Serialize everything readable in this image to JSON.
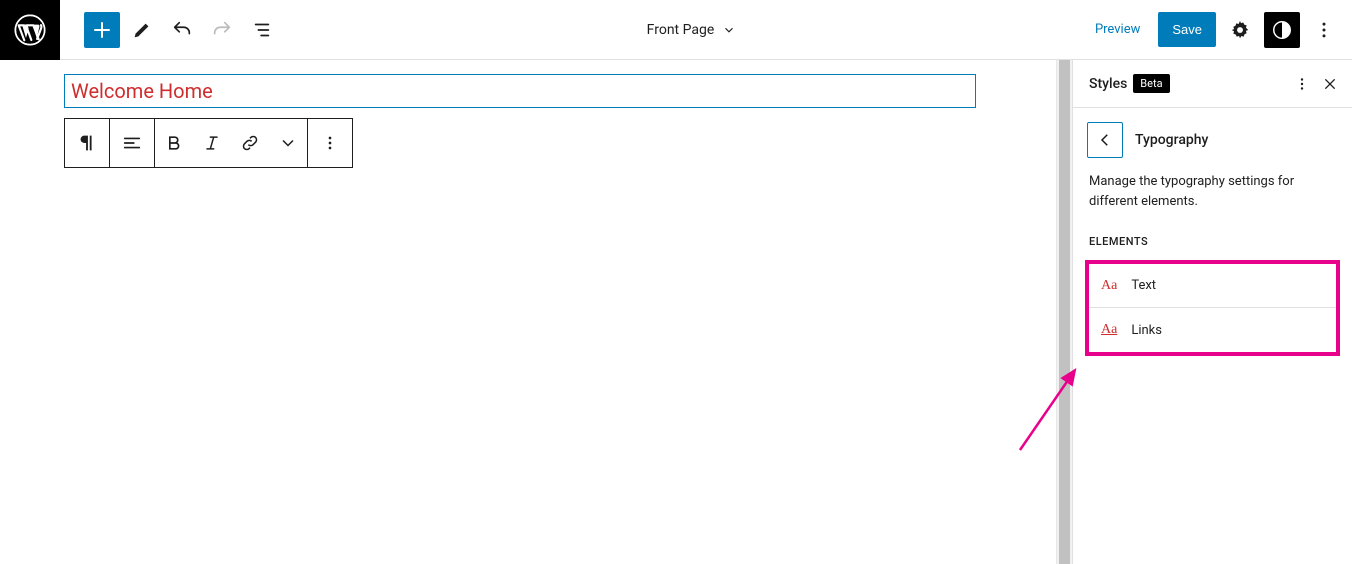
{
  "header": {
    "document_title": "Front Page",
    "preview_label": "Preview",
    "save_label": "Save"
  },
  "editor": {
    "title_text": "Welcome Home"
  },
  "sidebar": {
    "panel_title": "Styles",
    "badge": "Beta",
    "section_title": "Typography",
    "description": "Manage the typography settings for different elements.",
    "elements_heading": "ELEMENTS",
    "elements": [
      {
        "icon": "Aa",
        "label": "Text",
        "underline": false
      },
      {
        "icon": "Aa",
        "label": "Links",
        "underline": true
      }
    ]
  }
}
